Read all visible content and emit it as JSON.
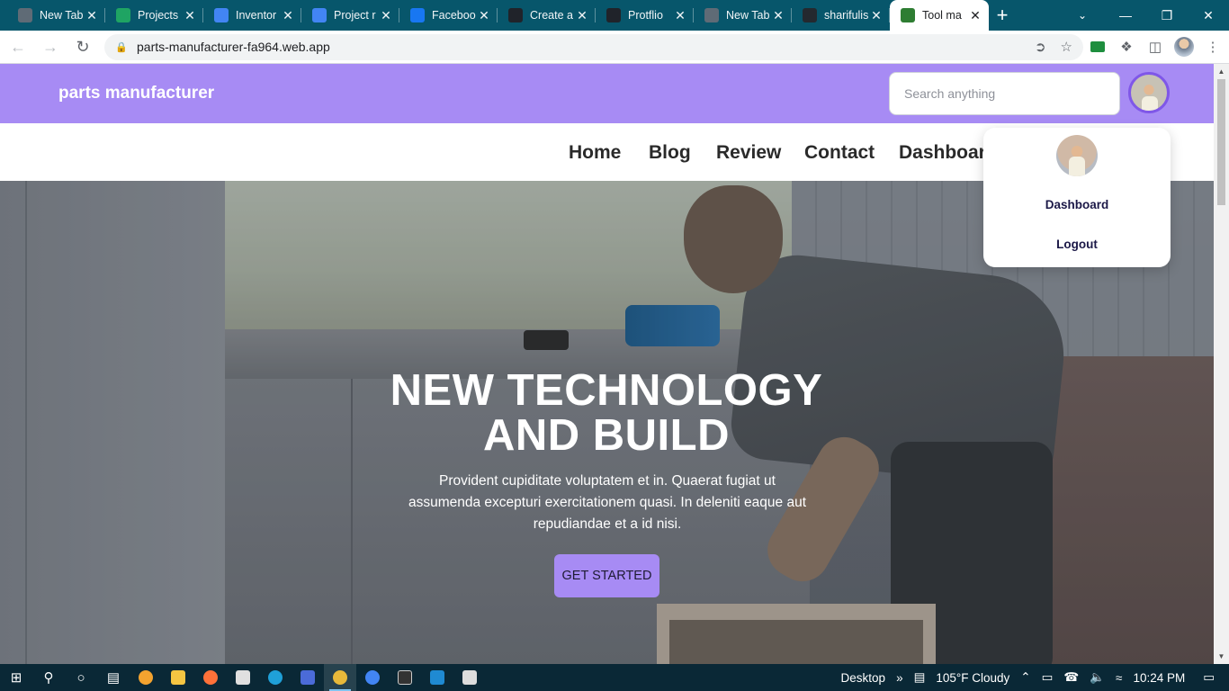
{
  "browser": {
    "tabs": [
      {
        "title": "New Tab",
        "icon": "chrome-icon",
        "color": "#5f6b76"
      },
      {
        "title": "Projects",
        "icon": "drive-icon",
        "color": "#1fa463"
      },
      {
        "title": "Inventor",
        "icon": "docs-icon",
        "color": "#4285f4"
      },
      {
        "title": "Project r",
        "icon": "docs-icon",
        "color": "#4285f4"
      },
      {
        "title": "Faceboo",
        "icon": "facebook-icon",
        "color": "#1877f2"
      },
      {
        "title": "Create a",
        "icon": "react-icon",
        "color": "#20232a"
      },
      {
        "title": "Protflio",
        "icon": "react-icon",
        "color": "#20232a"
      },
      {
        "title": "New Tab",
        "icon": "chrome-icon",
        "color": "#5f6b76"
      },
      {
        "title": "sharifulis",
        "icon": "github-icon",
        "color": "#24292f"
      },
      {
        "title": "Tool ma",
        "icon": "tool-icon",
        "color": "#2e7d32",
        "active": true
      }
    ],
    "url": "parts-manufacturer-fa964.web.app"
  },
  "site": {
    "brand": "parts manufacturer",
    "search_placeholder": "Search anything",
    "nav": [
      "Home",
      "Blog",
      "Review",
      "Contact",
      "Dashboard"
    ],
    "dropdown": {
      "item1": "Dashboard",
      "item2": "Logout"
    },
    "hero": {
      "title_line1": "NEW TECHNOLOGY",
      "title_line2": "AND BUILD",
      "text": "Provident cupiditate voluptatem et in. Quaerat fugiat ut assumenda excepturi exercitationem quasi. In deleniti eaque aut repudiandae et a id nisi.",
      "button": "GET STARTED"
    },
    "colors": {
      "accent": "#a78bf4",
      "profile_ring": "#7f57e8"
    }
  },
  "taskbar": {
    "desktop": "Desktop",
    "weather": "105°F  Cloudy",
    "time": "10:24 PM"
  }
}
